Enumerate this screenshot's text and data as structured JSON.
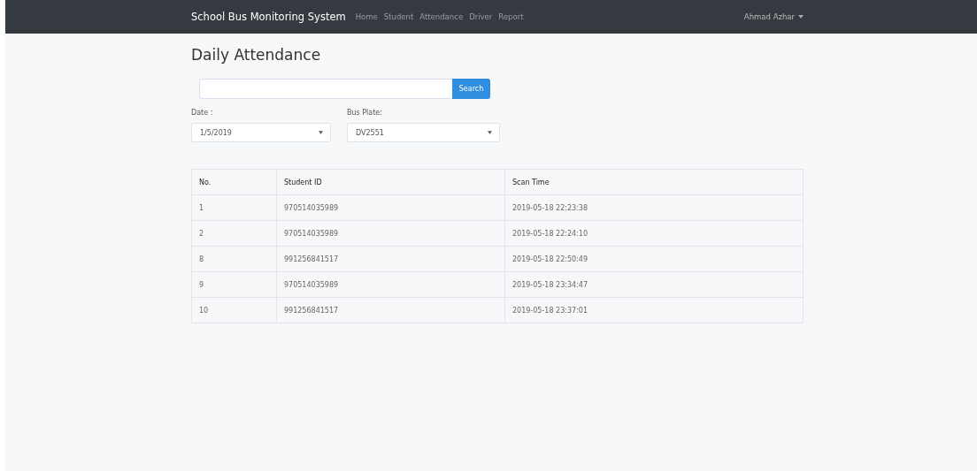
{
  "navbar": {
    "brand": "School Bus Monitoring System",
    "links": [
      "Home",
      "Student",
      "Attendance",
      "Driver",
      "Report"
    ],
    "user": "Ahmad Azhar"
  },
  "page_title": "Daily Attendance",
  "search": {
    "button": "Search"
  },
  "filters": [
    {
      "label": "Date :",
      "value": "1/5/2019"
    },
    {
      "label": "Bus Plate:",
      "value": "DV2551"
    }
  ],
  "table": {
    "columns": [
      "No.",
      "Student ID",
      "Scan Time"
    ],
    "rows": [
      [
        "1",
        "970514035989",
        "2019-05-18 22:23:38"
      ],
      [
        "2",
        "970514035989",
        "2019-05-18 22:24:10"
      ],
      [
        "8",
        "991256841517",
        "2019-05-18 22:50:49"
      ],
      [
        "9",
        "970514035989",
        "2019-05-18 23:34:47"
      ],
      [
        "10",
        "991256841517",
        "2019-05-18 23:37:01"
      ]
    ]
  }
}
